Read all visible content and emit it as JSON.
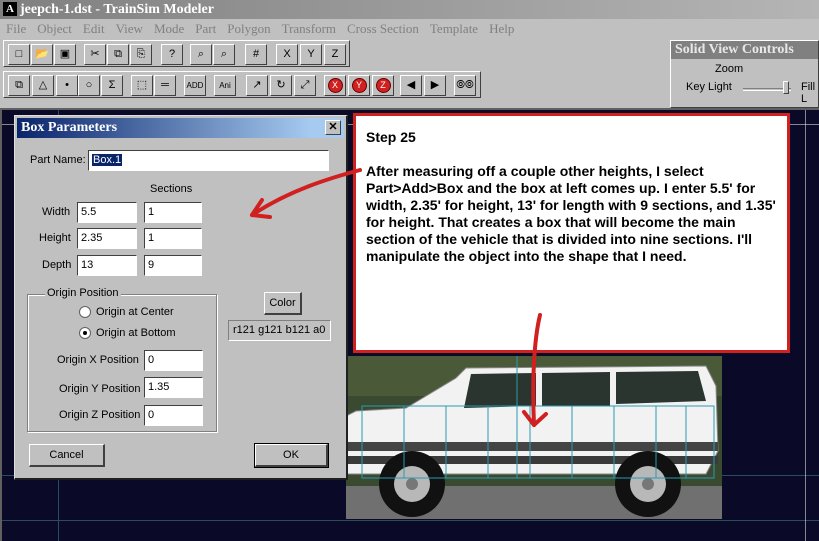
{
  "window": {
    "title": "jeepch-1.dst - TrainSim Modeler",
    "app_icon": "A"
  },
  "menu": [
    "File",
    "Object",
    "Edit",
    "View",
    "Mode",
    "Part",
    "Polygon",
    "Transform",
    "Cross Section",
    "Template",
    "Help"
  ],
  "toolbar_row1": [
    {
      "name": "new-icon",
      "glyph": "□"
    },
    {
      "name": "open-icon",
      "glyph": "📂"
    },
    {
      "name": "save-icon",
      "glyph": "▣"
    },
    {
      "name": "cut-icon",
      "glyph": "✂"
    },
    {
      "name": "copy-icon",
      "glyph": "⧉"
    },
    {
      "name": "paste-icon",
      "glyph": "⎘"
    },
    {
      "name": "help-icon",
      "glyph": "?"
    },
    {
      "name": "zoom-in-icon",
      "glyph": "⌕"
    },
    {
      "name": "zoom-out-icon",
      "glyph": "⌕"
    },
    {
      "name": "grid-icon",
      "glyph": "#"
    },
    {
      "name": "axis-x-icon",
      "glyph": "X"
    },
    {
      "name": "axis-y-icon",
      "glyph": "Y"
    },
    {
      "name": "axis-z-icon",
      "glyph": "Z"
    }
  ],
  "toolbar_row2": [
    {
      "name": "select-part-icon",
      "glyph": "⧉"
    },
    {
      "name": "select-polygon-icon",
      "glyph": "△"
    },
    {
      "name": "select-point-icon",
      "glyph": "•"
    },
    {
      "name": "circle-icon",
      "glyph": "○"
    },
    {
      "name": "sigma-icon",
      "glyph": "Σ"
    },
    {
      "name": "marquee-icon",
      "glyph": "⬚"
    },
    {
      "name": "ruler-icon",
      "glyph": "═"
    },
    {
      "name": "add-icon",
      "glyph": "ADD"
    },
    {
      "name": "animate-icon",
      "glyph": "Ani"
    },
    {
      "name": "move-icon",
      "glyph": "↗"
    },
    {
      "name": "rotate-icon",
      "glyph": "↻"
    },
    {
      "name": "scale-icon",
      "glyph": "⤢"
    },
    {
      "name": "no-x-icon",
      "glyph": "X"
    },
    {
      "name": "no-y-icon",
      "glyph": "Y"
    },
    {
      "name": "no-z-icon",
      "glyph": "Z"
    },
    {
      "name": "arrow-left-icon",
      "glyph": "◀"
    },
    {
      "name": "arrow-right-icon",
      "glyph": "▶"
    },
    {
      "name": "binoculars-icon",
      "glyph": "⦾⦾"
    }
  ],
  "solid_view": {
    "title": "Solid View Controls",
    "zoom_label": "Zoom",
    "key_light_label": "Key Light",
    "fill_label": "Fill L"
  },
  "dialog": {
    "title": "Box Parameters",
    "part_name_label": "Part Name:",
    "part_name_value": "Box.1",
    "sections_header": "Sections",
    "width_label": "Width",
    "width_value": "5.5",
    "width_sections": "1",
    "height_label": "Height",
    "height_value": "2.35",
    "height_sections": "1",
    "depth_label": "Depth",
    "depth_value": "13",
    "depth_sections": "9",
    "origin_group_label": "Origin Position",
    "origin_center_label": "Origin at Center",
    "origin_bottom_label": "Origin at Bottom",
    "origin_bottom_selected": true,
    "origin_x_label": "Origin X Position",
    "origin_x_value": "0",
    "origin_y_label": "Origin Y Position",
    "origin_y_value": "1.35",
    "origin_z_label": "Origin Z Position",
    "origin_z_value": "0",
    "color_button": "Color",
    "color_value": "r121 g121 b121 a0",
    "cancel_button": "Cancel",
    "ok_button": "OK"
  },
  "annotation": {
    "step": "Step 25",
    "body": "After measuring off a couple other heights, I select Part>Add>Box and the box at left comes up. I enter 5.5' for width, 2.35' for height, 13' for length with 9 sections, and 1.35' for height. That creates a box that will become the main section of the vehicle that is divided into nine sections. I'll manipulate the object into the shape that I need."
  },
  "colors": {
    "accent_red": "#d02020",
    "viewport_bg": "#0a0a28",
    "wireframe": "#2a9ab0"
  }
}
